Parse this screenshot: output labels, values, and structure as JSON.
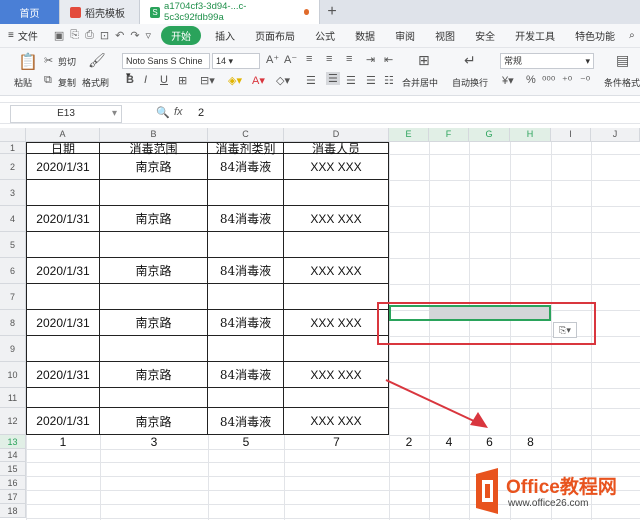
{
  "tabs": {
    "home": "首页",
    "template": "稻壳模板",
    "file": "a1704cf3-3d94-...c-5c3c92fdb99a"
  },
  "menu": {
    "file": "文件",
    "start": "开始",
    "insert": "插入",
    "layout": "页面布局",
    "formula": "公式",
    "data": "数据",
    "review": "审阅",
    "view": "视图",
    "security": "安全",
    "dev": "开发工具",
    "special": "特色功能"
  },
  "ribbon": {
    "cut": "剪切",
    "paste": "粘贴",
    "copy": "复制",
    "format_painter": "格式刷",
    "font": "Noto Sans S Chine",
    "size": "14",
    "merge_center": "合并居中",
    "wrap": "自动换行",
    "number_format": "常规",
    "cond_format": "条件格式"
  },
  "formula_bar": {
    "cell_ref": "E13",
    "fx": "fx",
    "value": "2"
  },
  "columns": [
    "A",
    "B",
    "C",
    "D",
    "E",
    "F",
    "G",
    "H",
    "I",
    "J"
  ],
  "rows": [
    "1",
    "2",
    "3",
    "4",
    "5",
    "6",
    "7",
    "8",
    "9",
    "10",
    "11",
    "12",
    "13",
    "14",
    "15",
    "16",
    "17",
    "18"
  ],
  "table": {
    "headers": [
      "日期",
      "消毒范围",
      "消毒剂类别",
      "消毒人员"
    ],
    "r2": [
      "2020/1/31",
      "南京路",
      "84消毒液",
      "XXX XXX"
    ],
    "r4": [
      "2020/1/31",
      "南京路",
      "84消毒液",
      "XXX XXX"
    ],
    "r6": [
      "2020/1/31",
      "南京路",
      "84消毒液",
      "XXX XXX"
    ],
    "r8": [
      "2020/1/31",
      "南京路",
      "84消毒液",
      "XXX XXX"
    ],
    "r10": [
      "2020/1/31",
      "南京路",
      "84消毒液",
      "XXX XXX"
    ],
    "r12": [
      "2020/1/31",
      "南京路",
      "84消毒液",
      "XXX XXX"
    ],
    "r13_left": [
      "1",
      "3",
      "5",
      "7"
    ],
    "r13_right": [
      "2",
      "4",
      "6",
      "8"
    ]
  },
  "watermark": {
    "brand": "Office教程网",
    "url": "www.office26.com"
  },
  "colors": {
    "accent_green": "#2aa35b",
    "red_box": "#d9363e",
    "logo_orange": "#e8531e"
  }
}
